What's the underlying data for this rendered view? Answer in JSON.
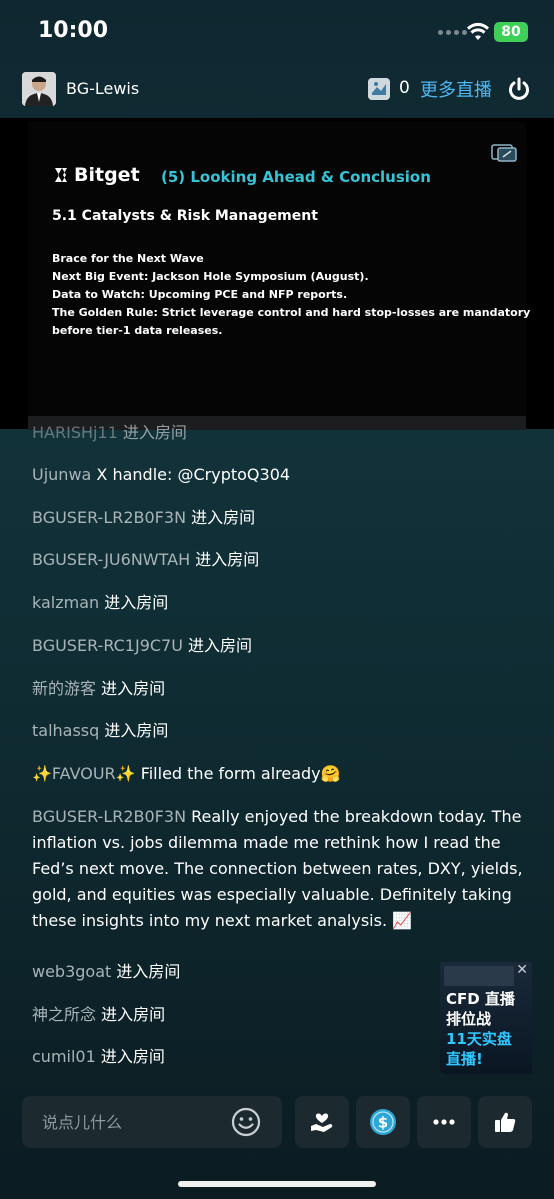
{
  "status_bar": {
    "time": "10:00",
    "battery": "80"
  },
  "header": {
    "host_name": "BG-Lewis",
    "gift_count": "0",
    "more_live": "更多直播"
  },
  "slide": {
    "brand": "Bitget",
    "section_title": "(5) Looking Ahead & Conclusion",
    "subhead": "5.1 Catalysts & Risk Management",
    "lines": [
      "Brace for the Next Wave",
      "Next Big Event: Jackson Hole Symposium (August).",
      "Data to Watch: Upcoming PCE and NFP reports.",
      "The Golden Rule: Strict leverage control and hard stop-losses are mandatory",
      "before tier-1 data releases."
    ]
  },
  "chat": {
    "partial_top": {
      "user": "HARISHj11",
      "text": "进入房间"
    },
    "messages": [
      {
        "user": "Ujunwa",
        "text": "X handle: @CryptoQ304"
      },
      {
        "user": "BGUSER-LR2B0F3N",
        "text": "进入房间"
      },
      {
        "user": "BGUSER-JU6NWTAH",
        "text": "进入房间"
      },
      {
        "user": "kalzman",
        "text": "进入房间"
      },
      {
        "user": "BGUSER-RC1J9C7U",
        "text": "进入房间"
      },
      {
        "user": "新的游客",
        "text": "进入房间"
      },
      {
        "user": "talhassq",
        "text": "进入房间"
      },
      {
        "user": "✨FAVOUR✨",
        "text": "Filled the form already🤗"
      },
      {
        "user": "BGUSER-LR2B0F3N",
        "text": "Really enjoyed the breakdown today. The inflation vs. jobs dilemma made me rethink how I read the Fed’s next move. The connection between rates, DXY, yields, gold, and equities was especially valuable. Definitely taking these insights into my next market analysis. 📈"
      },
      {
        "user": "web3goat",
        "text": "进入房间"
      },
      {
        "user": "神之所念",
        "text": "进入房间"
      },
      {
        "user": "cumil01",
        "text": "进入房间"
      }
    ]
  },
  "ad": {
    "line1": "CFD 直播",
    "line2": "排位战",
    "line3": "11天实盘",
    "line4": "直播!"
  },
  "bottom_bar": {
    "comment_placeholder": "说点儿什么"
  },
  "colors": {
    "accent_blue": "#4fb7f2",
    "slide_title": "#36c4d6",
    "username_gray": "#a9b4b6",
    "battery_green": "#3fcf59"
  }
}
